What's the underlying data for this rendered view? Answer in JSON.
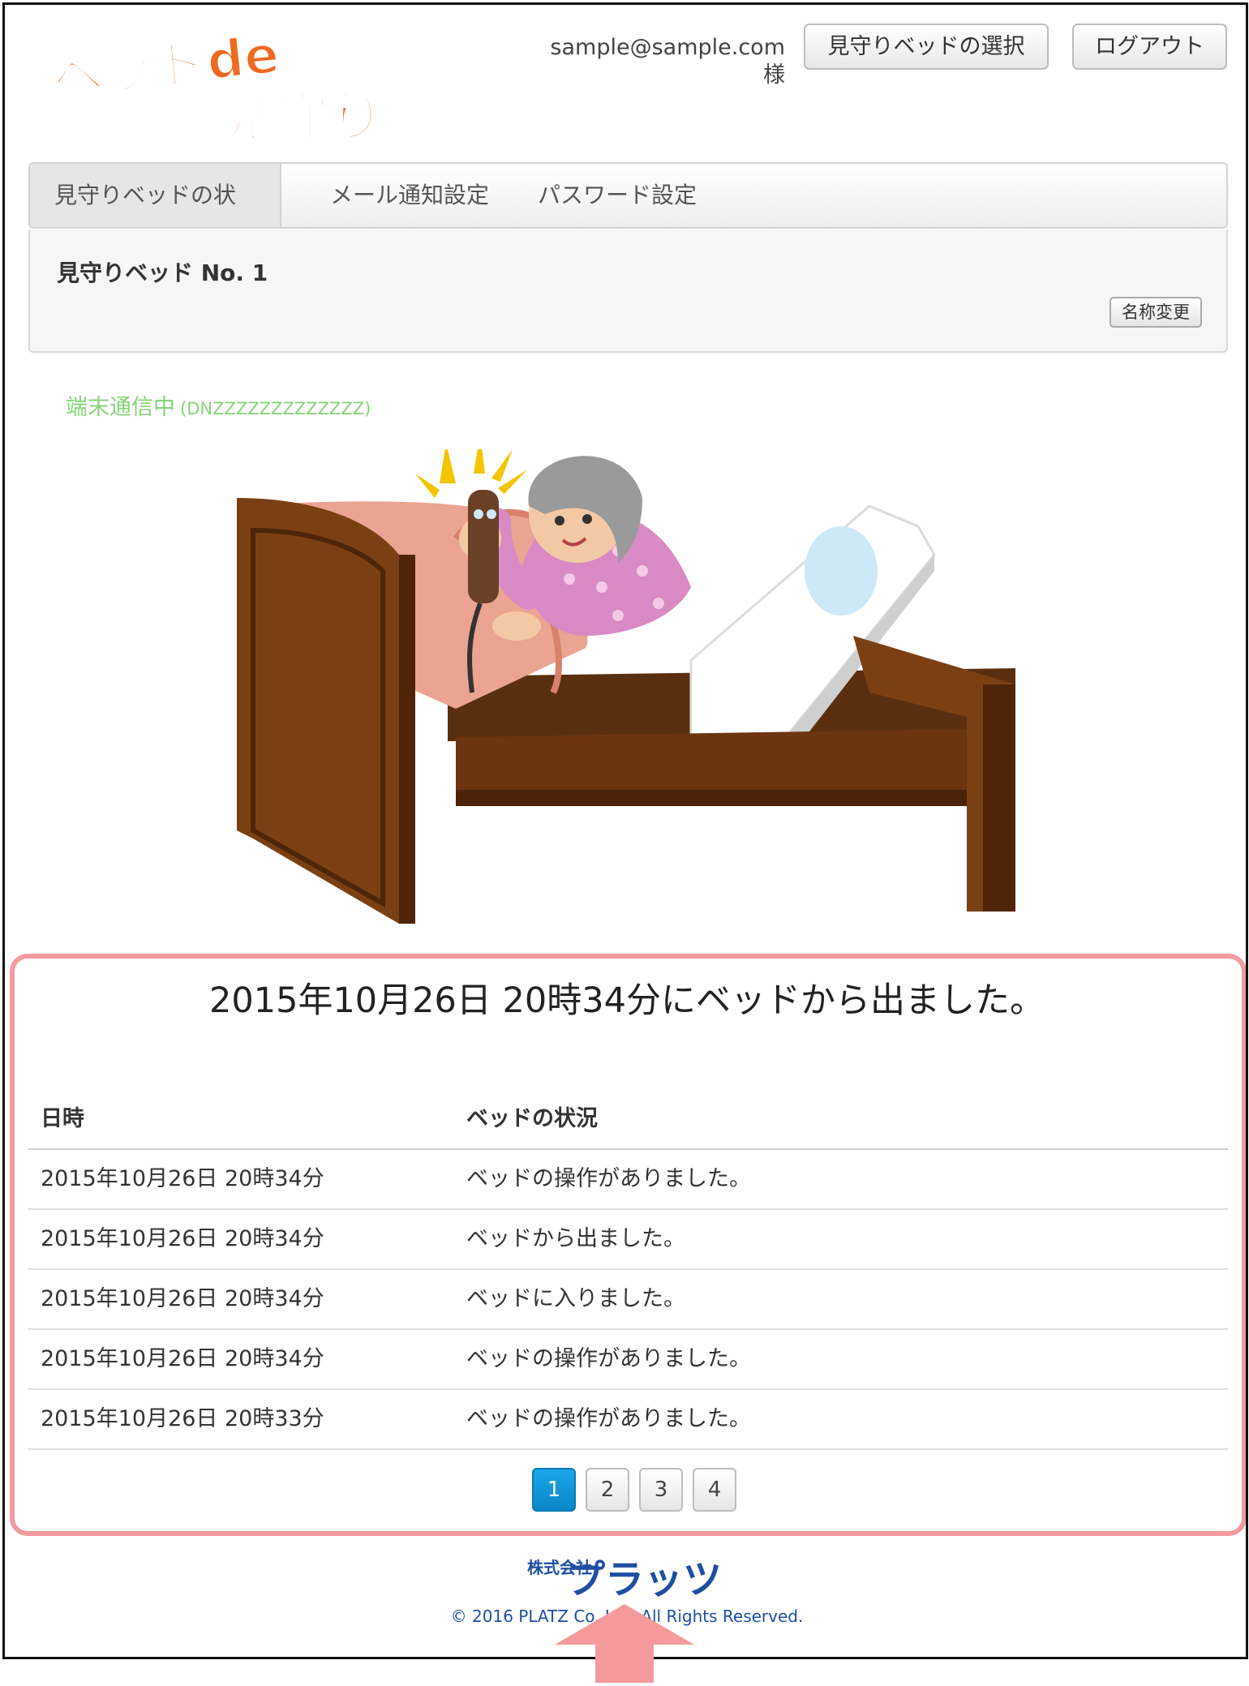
{
  "header": {
    "logo_text_top": "ベッドde",
    "logo_text_bottom": "見守り隊",
    "user_email": "sample@sample.com 様",
    "bed_select_label": "見守りベッドの選択",
    "logout_label": "ログアウト"
  },
  "nav": {
    "tabs": [
      {
        "label": "見守りベッドの状況"
      },
      {
        "label": "メール通知設定"
      },
      {
        "label": "パスワード設定"
      }
    ]
  },
  "bed_panel": {
    "name": "見守りベッド No. 1",
    "rename_label": "名称変更"
  },
  "status": {
    "text": "端末通信中",
    "device_id": "(DNZZZZZZZZZZZZZ)"
  },
  "summary": "2015年10月26日 20時34分にベッドから出ました。",
  "table": {
    "headers": [
      "日時",
      "ベッドの状況"
    ],
    "rows": [
      {
        "datetime": "2015年10月26日 20時34分",
        "state": "ベッドの操作がありました。"
      },
      {
        "datetime": "2015年10月26日 20時34分",
        "state": "ベッドから出ました。"
      },
      {
        "datetime": "2015年10月26日 20時34分",
        "state": "ベッドに入りました。"
      },
      {
        "datetime": "2015年10月26日 20時34分",
        "state": "ベッドの操作がありました。"
      },
      {
        "datetime": "2015年10月26日 20時33分",
        "state": "ベッドの操作がありました。"
      }
    ]
  },
  "pagination": {
    "pages": [
      "1",
      "2",
      "3",
      "4"
    ],
    "current": "1"
  },
  "footer": {
    "company_logo_small": "株式会社",
    "company_logo_main": "プラッツ",
    "copyright": "© 2016 PLATZ Co.,Ltd. All Rights Reserved."
  },
  "colors": {
    "status_green": "#86d479",
    "highlight_pink": "#f39aa0",
    "pager_active_blue": "#0a86c7",
    "logo_orange": "#ef6a1e",
    "footer_blue": "#1e4fa3"
  }
}
